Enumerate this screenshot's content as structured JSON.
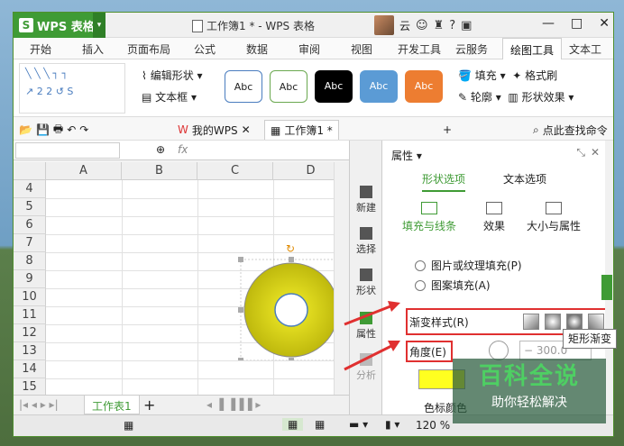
{
  "app": {
    "name": "WPS 表格",
    "doc_title": "工作簿1 * - WPS 表格",
    "user": "云"
  },
  "menu_tabs": [
    "开始",
    "插入",
    "页面布局",
    "公式",
    "数据",
    "审阅",
    "视图",
    "开发工具",
    "云服务",
    "绘图工具",
    "文本工"
  ],
  "ribbon": {
    "edit_shape": "编辑形状",
    "textbox": "文本框",
    "style_label": "Abc",
    "fill": "填充",
    "format_brush": "格式刷",
    "outline": "轮廓",
    "shape_effect": "形状效果"
  },
  "doc_tabs": {
    "wps": "我的WPS",
    "book": "工作簿1 *",
    "search": "点此查找命令"
  },
  "formula": {
    "fx": "fx"
  },
  "columns": [
    "A",
    "B",
    "C",
    "D"
  ],
  "rows": [
    "4",
    "5",
    "6",
    "7",
    "8",
    "9",
    "10",
    "11",
    "12",
    "13",
    "14",
    "15"
  ],
  "sheet": {
    "name": "工作表1",
    "add": "+"
  },
  "status": {
    "zoom": "120 %"
  },
  "side_strip": [
    "新建",
    "选择",
    "形状",
    "属性",
    "分析"
  ],
  "panel": {
    "title": "属性",
    "tab_shape": "形状选项",
    "tab_text": "文本选项",
    "sub_fill": "填充与线条",
    "sub_effect": "效果",
    "sub_size": "大小与属性",
    "opt_picture": "图片或纹理填充(P)",
    "opt_pattern": "图案填充(A)",
    "gradient_style": "渐变样式(R)",
    "angle": "角度(E)",
    "angle_value": "300.0",
    "color_stop": "色标颜色"
  },
  "tooltip": "矩形渐变",
  "watermark": {
    "title": "百科全说",
    "subtitle": "助你轻松解决"
  },
  "colors": {
    "brand_green": "#3f9b35",
    "shape_yellow": "#d4cf0a",
    "highlight_red": "#e03030"
  }
}
